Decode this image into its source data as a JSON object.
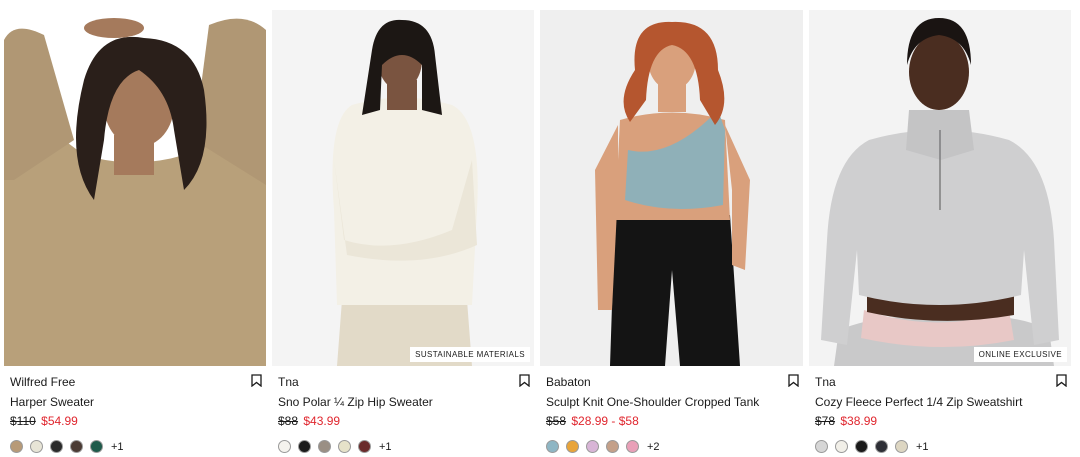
{
  "products": [
    {
      "brand": "Wilfred Free",
      "name": "Harper Sweater",
      "original_price": "$110",
      "sale_price": "$54.99",
      "tag": "",
      "swatches": [
        "#b79a78",
        "#e7e4d6",
        "#2a2a2a",
        "#4a3b34",
        "#1f5a4a"
      ],
      "more_colors": "+1",
      "image": {
        "bg": "#ffffff",
        "garment": "#b8a07a",
        "skin": "#a57a5c",
        "hair": "#2a1f1a"
      }
    },
    {
      "brand": "Tna",
      "name": "Sno Polar ¼ Zip Hip Sweater",
      "original_price": "$88",
      "sale_price": "$43.99",
      "tag": "SUSTAINABLE MATERIALS",
      "swatches": [
        "#f5f3ee",
        "#1a1a1a",
        "#9a8f84",
        "#e6e2c9",
        "#6a2b2b"
      ],
      "more_colors": "+1",
      "image": {
        "bg": "#f4f4f4",
        "garment": "#f3f0e6",
        "skin": "#7a5440",
        "hair": "#1c1714"
      }
    },
    {
      "brand": "Babaton",
      "name": "Sculpt Knit One-Shoulder Cropped Tank",
      "original_price": "$58",
      "sale_price": "$28.99 - $58",
      "tag": "",
      "swatches": [
        "#8fb6c4",
        "#e8a43a",
        "#d8b5d6",
        "#c4a089",
        "#e9a0b8"
      ],
      "more_colors": "+2",
      "image": {
        "bg": "#efefef",
        "garment": "#8fb0b8",
        "skin": "#d9a07c",
        "hair": "#b5562f"
      }
    },
    {
      "brand": "Tna",
      "name": "Cozy Fleece Perfect 1/4 Zip Sweatshirt",
      "original_price": "$78",
      "sale_price": "$38.99",
      "tag": "ONLINE EXCLUSIVE",
      "swatches": [
        "#d6d6d6",
        "#f1efe8",
        "#1a1a1a",
        "#2e2f36",
        "#ddd6c2"
      ],
      "more_colors": "+1",
      "image": {
        "bg": "#f3f3f3",
        "garment": "#cfcfd0",
        "skin": "#4a2d20",
        "hair": "#1a1412"
      }
    }
  ]
}
